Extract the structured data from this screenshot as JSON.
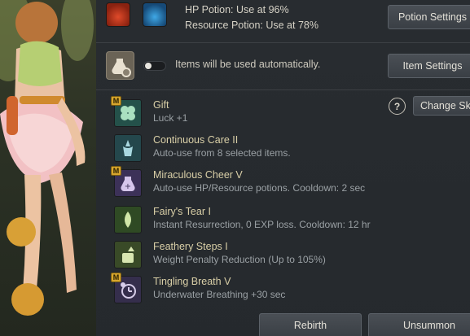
{
  "potions": {
    "hp_label": "HP Potion: Use at 96%",
    "resource_label": "Resource Potion: Use at 78%",
    "settings_button": "Potion Settings"
  },
  "auto_use": {
    "text": "Items will be used automatically.",
    "toggle_on": false,
    "settings_button": "Item Settings"
  },
  "change_button": "Change Sk",
  "help_glyph": "?",
  "skills": [
    {
      "badge": "M",
      "name": "Gift",
      "desc": "Luck +1",
      "icon": "clover-icon",
      "color": "#3f7e6e"
    },
    {
      "badge": "",
      "name": "Continuous Care II",
      "desc": "Auto-use from 8 selected items.",
      "icon": "fairy-icon",
      "color": "#3b6d72"
    },
    {
      "badge": "M",
      "name": "Miraculous Cheer V",
      "desc": "Auto-use HP/Resource potions. Cooldown: 2 sec",
      "icon": "potion-plus-icon",
      "color": "#5a4a78"
    },
    {
      "badge": "",
      "name": "Fairy's Tear I",
      "desc": "Instant Resurrection, 0 EXP loss. Cooldown: 12 hr",
      "icon": "tear-icon",
      "color": "#4c6d3a"
    },
    {
      "badge": "",
      "name": "Feathery Steps I",
      "desc": "Weight Penalty Reduction (Up to 105%)",
      "icon": "weight-icon",
      "color": "#566b3c"
    },
    {
      "badge": "M",
      "name": "Tingling Breath V",
      "desc": "Underwater Breathing +30 sec",
      "icon": "breath-timer-icon",
      "color": "#4e4468"
    }
  ],
  "footer": {
    "rebirth": "Rebirth",
    "unsummon": "Unsummon"
  }
}
